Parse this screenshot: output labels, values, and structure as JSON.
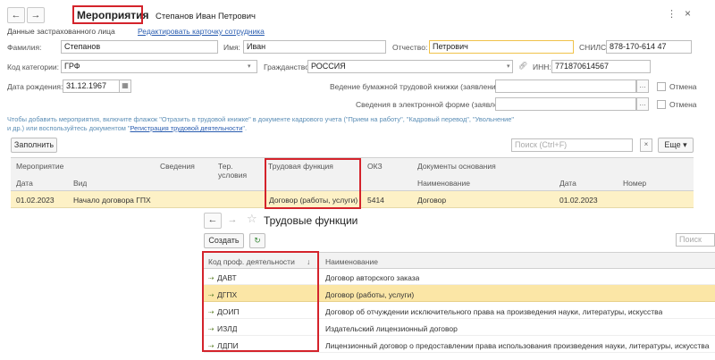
{
  "nav": {
    "back": "←",
    "forward": "→"
  },
  "title": "Мероприятия",
  "employee_name": "Степанов Иван Петрович",
  "window_controls": {
    "menu": "⋮",
    "close": "×"
  },
  "subheader": {
    "label": "Данные застрахованного лица",
    "edit_link": "Редактировать карточку сотрудника"
  },
  "person": {
    "last_name_label": "Фамилия:",
    "last_name": "Степанов",
    "first_name_label": "Имя:",
    "first_name": "Иван",
    "patronymic_label": "Отчество:",
    "patronymic": "Петрович",
    "snils_label": "СНИЛС:",
    "snils": "878-170-614 47",
    "category_label": "Код категории:",
    "category": "ГРФ",
    "citizenship_label": "Гражданство:",
    "citizenship": "РОССИЯ",
    "inn_label": "ИНН:",
    "inn": "771870614567",
    "birth_label": "Дата рождения:",
    "birth": "31.12.1967",
    "paper_book_label": "Ведение бумажной трудовой книжки (заявление):",
    "electronic_label": "Сведения в электронной форме (заявление):",
    "cancel_label": "Отмена",
    "cancel_label2": "Отмена"
  },
  "hint": {
    "line1": "Чтобы добавить мероприятия, включите флажок \"Отразить в трудовой книжке\" в документе кадрового учета (\"Прием на работу\", \"Кадровый перевод\", \"Увольнение\"",
    "line2_pre": "и др.) или воспользуйтесь документом \"",
    "line2_link": "Регистрация трудовой деятельности",
    "line2_post": "\"."
  },
  "toolbar": {
    "fill": "Заполнить",
    "search_placeholder": "Поиск (Ctrl+F)",
    "more": "Еще ▾",
    "clear": "×"
  },
  "table": {
    "headers_top": [
      "Мероприятие",
      "Сведения",
      "Тер. условия",
      "Трудовая функция",
      "ОКЗ",
      "Документы основания"
    ],
    "headers_sub": [
      "Дата",
      "Вид",
      "Наименование",
      "Дата",
      "Номер"
    ],
    "row": {
      "date": "01.02.2023",
      "kind": "Начало договора ГПХ",
      "function": "Договор (работы, услуги)",
      "okz": "5414",
      "doc_name": "Договор",
      "doc_date": "01.02.2023",
      "doc_num": ""
    }
  },
  "popup": {
    "title": "Трудовые функции",
    "star": "☆",
    "create": "Создать",
    "search": "Поиск",
    "col_code": "Код проф. деятельности",
    "col_name": "Наименование",
    "sort": "↓",
    "rows": [
      {
        "code": "ДАВТ",
        "name": "Договор авторского заказа"
      },
      {
        "code": "ДГПХ",
        "name": "Договор (работы, услуги)"
      },
      {
        "code": "ДОИП",
        "name": "Договор об отчуждении исключительного права на произведения науки, литературы, искусства"
      },
      {
        "code": "ИЗЛД",
        "name": "Издательский лицензионный договор"
      },
      {
        "code": "ЛДПИ",
        "name": "Лицензионный договор о предоставлении права использования произведения науки, литературы, искусства,"
      }
    ]
  }
}
